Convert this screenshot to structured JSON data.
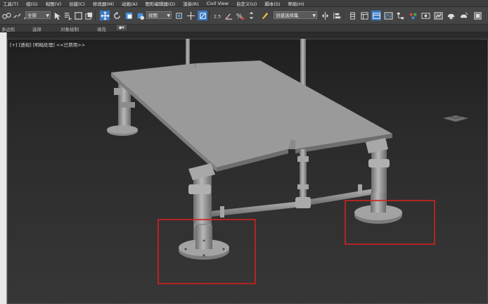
{
  "menu": [
    "工具(T)",
    "组(G)",
    "视图(V)",
    "创建(C)",
    "修改器(M)",
    "动画(A)",
    "图形编辑器(D)",
    "渲染(R)",
    "Civil View",
    "自定义(U)",
    "脚本(S)",
    "帮助(H)"
  ],
  "toolbar": {
    "selection_filter": "全部",
    "coord_system": "视图",
    "named_selection": "创建选择集"
  },
  "ribbon": {
    "tabs": [
      "多边形",
      "选择",
      "对象绘制",
      "填充"
    ]
  },
  "viewport": {
    "label": "[+] [透视] [明暗处理] <<已禁用>>"
  },
  "annotations": {
    "color": "#d42020"
  },
  "colors": {
    "accent_icon": "#4a90d9",
    "active_icon_bg": "#3a78c2",
    "model_grey": "#9a9a9a"
  },
  "icons": [
    "link-icon",
    "unlink-icon",
    "bind-icon",
    "select-object-icon",
    "select-by-name-icon",
    "rect-region-icon",
    "window-crossing-icon",
    "move-icon",
    "rotate-icon",
    "scale-icon",
    "pivot-icon",
    "manipulate-icon",
    "snap-toggle-icon",
    "angle-snap-icon",
    "percent-snap-icon",
    "spinner-snap-icon",
    "edit-named-sel-icon",
    "mirror-icon",
    "align-icon",
    "layer-icon",
    "ribbon-toggle-icon",
    "curve-editor-icon",
    "schematic-icon",
    "material-editor-icon",
    "render-setup-icon",
    "render-frame-icon",
    "render-icon",
    "render-online-icon"
  ]
}
